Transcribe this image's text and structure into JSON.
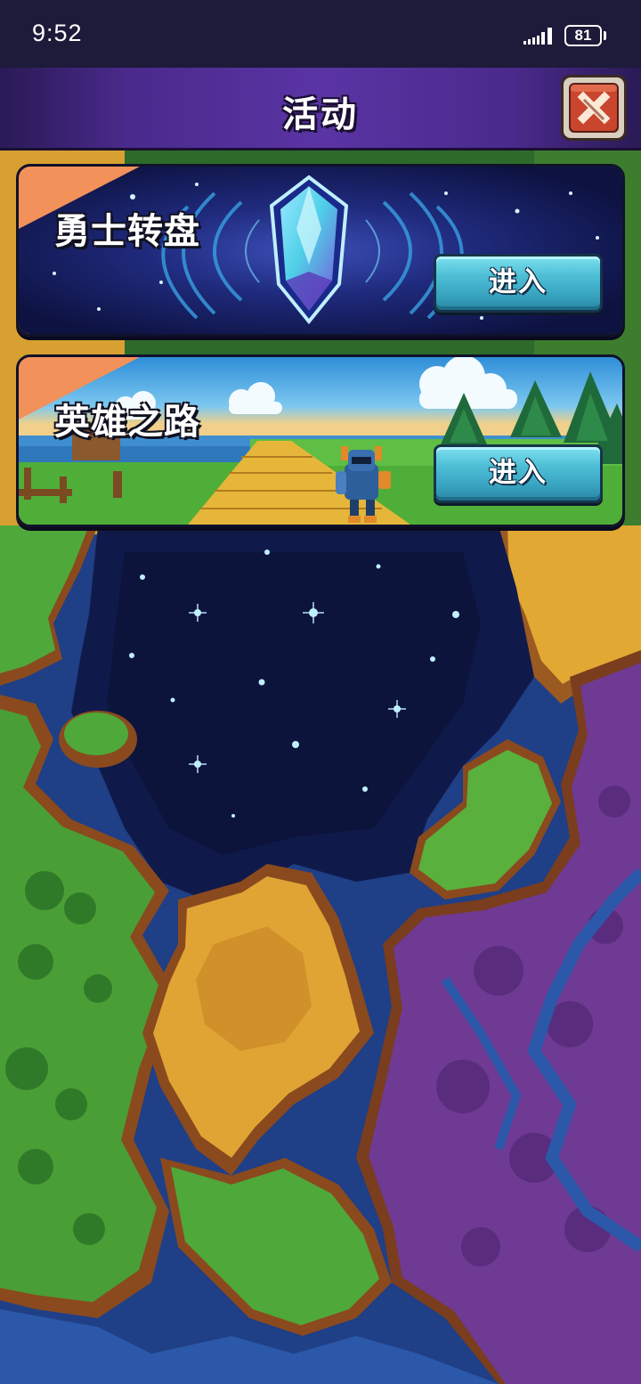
{
  "status_bar": {
    "time": "9:52",
    "battery": "81",
    "icons": [
      "signal-icon",
      "battery-icon"
    ]
  },
  "header": {
    "title": "活动",
    "close_icon": "close-icon"
  },
  "events": [
    {
      "title": "勇士转盘",
      "button_label": "进入",
      "art": "crystal-gem-icon",
      "theme_color": "#1a1f5c"
    },
    {
      "title": "英雄之路",
      "button_label": "进入",
      "art": "knight-road-icon",
      "theme_color": "#3a9ad8"
    }
  ],
  "colors": {
    "header_purple": "#4a2a8c",
    "corner_orange": "#f2915a",
    "button_cyan": "#4fbfd6",
    "close_red": "#c9452e"
  }
}
